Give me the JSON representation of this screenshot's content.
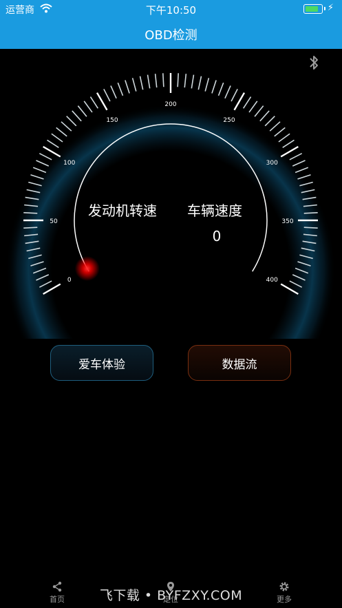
{
  "status_bar": {
    "carrier": "运营商",
    "time": "下午10:50"
  },
  "nav": {
    "title": "OBD检测"
  },
  "gauge": {
    "tick_labels": [
      "0",
      "50",
      "100",
      "150",
      "200",
      "250",
      "300",
      "350",
      "400"
    ],
    "min": 0,
    "max": 400,
    "needle_value": 0,
    "accent_color": "#1e7fb0",
    "needle_color": "#ff1a1a"
  },
  "labels": {
    "rpm": "发动机转速",
    "speed": "车辆速度",
    "speed_value": "0"
  },
  "buttons": {
    "car_experience": "爱车体验",
    "data_stream": "数据流"
  },
  "tabs": {
    "home": "首页",
    "locate": "定位",
    "more": "更多"
  },
  "watermark": "飞下载 • BYFZXY.COM"
}
